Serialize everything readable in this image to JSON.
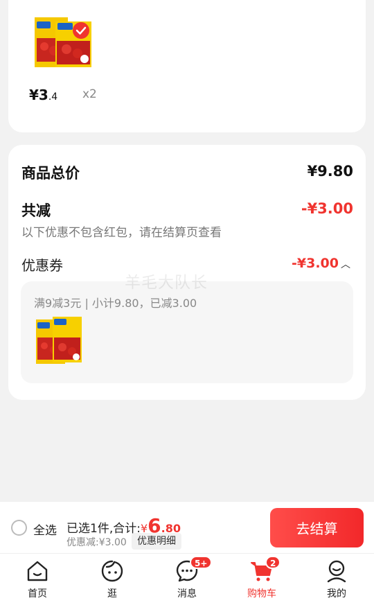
{
  "product": {
    "price_symbol": "¥3",
    "price_decimal": ".4",
    "quantity": "x2"
  },
  "summary": {
    "goods_total_label": "商品总价",
    "goods_total_value": "¥9.80",
    "discount_label": "共减",
    "discount_value": "-¥3.00",
    "note": "以下优惠不包含红包，请在结算页查看",
    "coupon_label": "优惠券",
    "coupon_value": "-¥3.00",
    "coupon_desc": "满9减3元 | 小计9.80，已减3.00"
  },
  "watermark": "羊毛大队长",
  "checkout": {
    "select_all": "全选",
    "selected_text": "已选1件,合计:",
    "currency": "¥",
    "total_int": "6",
    "total_dec": ".80",
    "discount_text": "优惠减:¥3.00",
    "detail_label": "优惠明细",
    "button_label": "去结算"
  },
  "tabs": [
    {
      "label": "首页",
      "icon": "home-icon"
    },
    {
      "label": "逛",
      "icon": "browse-icon"
    },
    {
      "label": "消息",
      "icon": "message-icon",
      "badge": "5+"
    },
    {
      "label": "购物车",
      "icon": "cart-icon",
      "badge": "2",
      "active": true
    },
    {
      "label": "我的",
      "icon": "profile-icon"
    }
  ],
  "colors": {
    "accent": "#f0342f",
    "background": "#f2f2f2"
  }
}
